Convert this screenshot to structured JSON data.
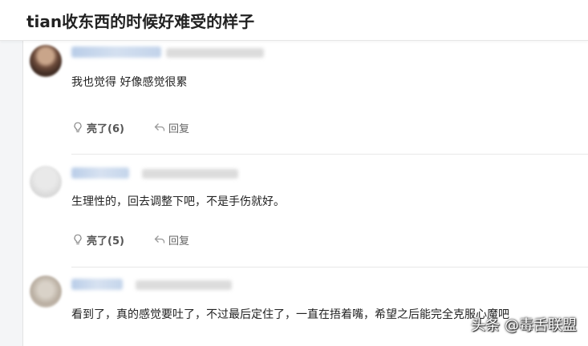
{
  "header": {
    "title": "tian收东西的时候好难受的样子"
  },
  "comments": [
    {
      "author": "",
      "time": "",
      "text": "我也觉得 好像感觉很累",
      "like_label": "亮了(6)",
      "reply_label": "回复"
    },
    {
      "author": "",
      "time": "",
      "text": "生理性的，回去调整下吧，不是手伤就好。",
      "like_label": "亮了(5)",
      "reply_label": "回复"
    },
    {
      "author": "",
      "time": "",
      "text": "看到了，真的感觉要吐了，不过最后定住了，一直在捂着嘴，希望之后能完全克服心魔吧",
      "like_label": "",
      "reply_label": ""
    }
  ],
  "watermark": {
    "text": "头条 @毒舌联盟"
  },
  "icons": {
    "like": "lightbulb-icon",
    "reply": "reply-arrow-icon"
  },
  "colors": {
    "text_primary": "#222222",
    "text_secondary": "#666666",
    "divider": "#e8e8e8",
    "background": "#f4f5f7"
  }
}
